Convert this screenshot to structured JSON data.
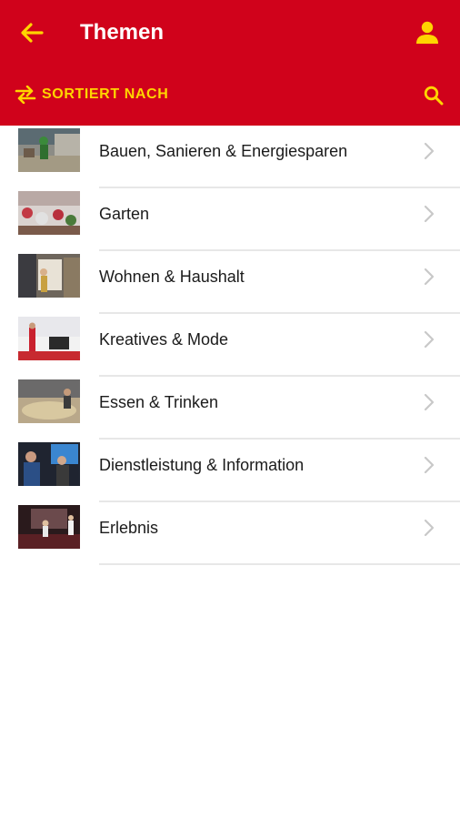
{
  "header": {
    "title": "Themen",
    "back_icon": "arrow-left-icon",
    "profile_icon": "person-icon",
    "sort_label": "SORTIERT NACH",
    "sort_icon": "swap-arrows-icon",
    "search_icon": "search-icon"
  },
  "colors": {
    "brand_red": "#d0021b",
    "accent_yellow": "#ffd500",
    "text": "#1b1b1b",
    "divider": "#e7e7e7",
    "chevron": "#c8c8c8"
  },
  "topics": [
    {
      "label": "Bauen, Sanieren & Energiesparen"
    },
    {
      "label": "Garten"
    },
    {
      "label": "Wohnen & Haushalt"
    },
    {
      "label": "Kreatives & Mode"
    },
    {
      "label": "Essen & Trinken"
    },
    {
      "label": "Dienstleistung & Information"
    },
    {
      "label": "Erlebnis"
    }
  ]
}
